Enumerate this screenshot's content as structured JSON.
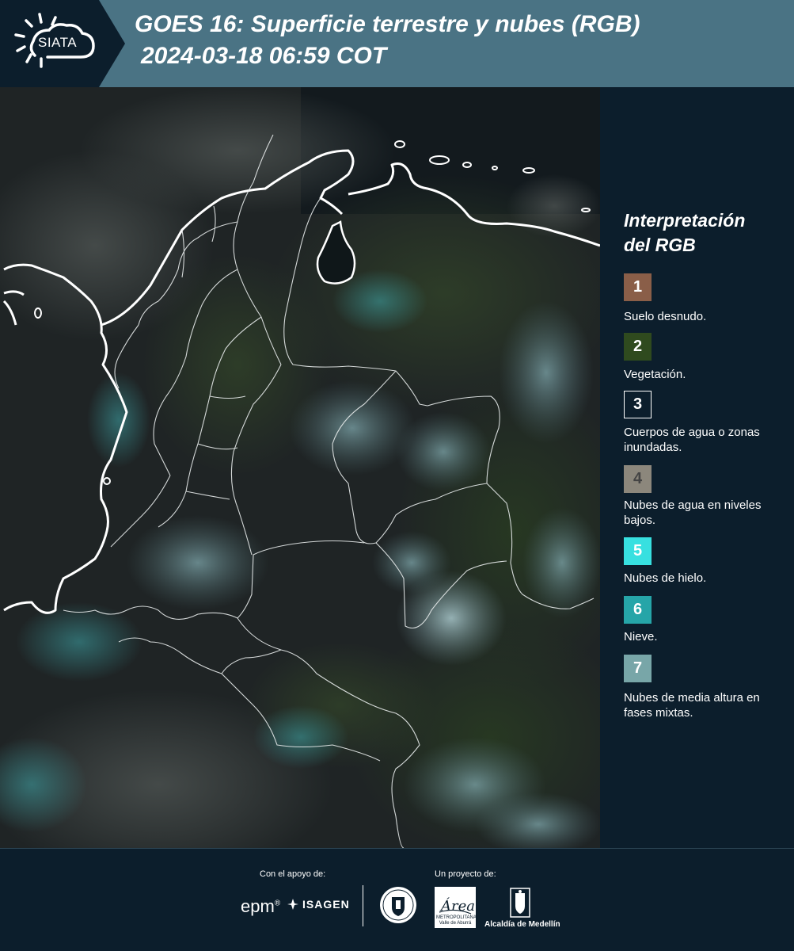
{
  "header": {
    "logo_text": "SIATA",
    "title_line1": "GOES 16: Superficie terrestre y nubes (RGB)",
    "title_line2": "2024-03-18 06:59 COT"
  },
  "legend": {
    "title_line1": "Interpretación",
    "title_line2": "del RGB",
    "items": [
      {
        "number": "1",
        "label": "Suelo desnudo.",
        "color": "#8a5e48"
      },
      {
        "number": "2",
        "label": "Vegetación.",
        "color": "#2f4a1e"
      },
      {
        "number": "3",
        "label": "Cuerpos de agua o zonas inundadas.",
        "color": "#0c1e2c"
      },
      {
        "number": "4",
        "label": "Nubes de agua en niveles bajos.",
        "color": "#8c877c"
      },
      {
        "number": "5",
        "label": "Nubes de hielo.",
        "color": "#37e0e0"
      },
      {
        "number": "6",
        "label": "Nieve.",
        "color": "#26a5a8"
      },
      {
        "number": "7",
        "label": "Nubes de media altura en fases mixtas.",
        "color": "#78a6a8"
      }
    ]
  },
  "footer": {
    "support_label": "Con el apoyo de:",
    "project_label": "Un proyecto de:",
    "epm": "epm",
    "epm_mark": "®",
    "isagen": "ISAGEN",
    "area_text": "METROPOLITANA Valle de Aburrá",
    "area_script": "Área",
    "alcaldia": "Alcaldía de Medellín"
  },
  "colors": {
    "header_bg": "#4a7384",
    "page_bg": "#0c1e2c"
  }
}
